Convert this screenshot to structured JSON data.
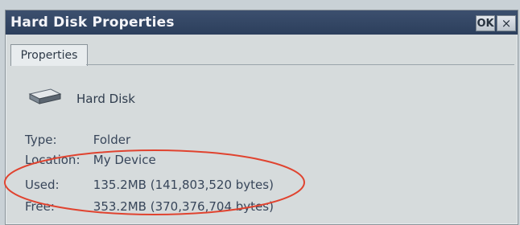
{
  "window": {
    "title": "Hard Disk Properties",
    "ok_label": "OK",
    "close_label": "×"
  },
  "tabs": [
    {
      "label": "Properties"
    }
  ],
  "device": {
    "icon": "hard-disk-icon",
    "name": "Hard Disk"
  },
  "properties": [
    {
      "label": "Type:",
      "value": "Folder"
    },
    {
      "label": "Location:",
      "value": "My Device"
    },
    {
      "label": "Used:",
      "value": "135.2MB (141,803,520 bytes)"
    },
    {
      "label": "Free:",
      "value": "353.2MB (370,376,704 bytes)"
    }
  ],
  "colors": {
    "titlebar": "#2f4361",
    "highlight_ellipse": "#e0432f"
  }
}
